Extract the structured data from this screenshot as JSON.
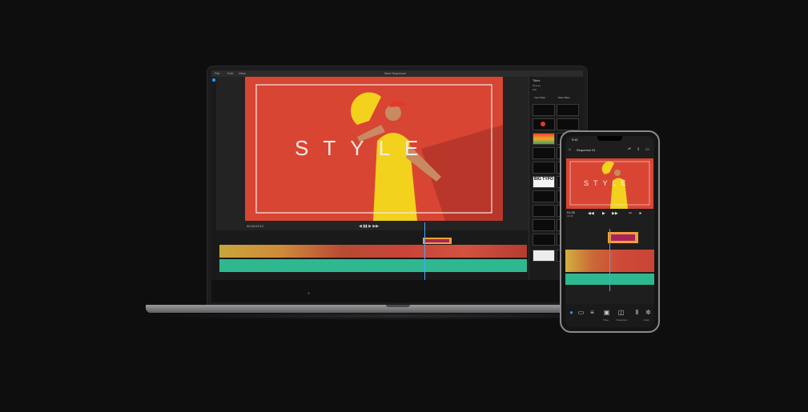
{
  "desktop_app": {
    "window_title": "New Sequence",
    "menu": [
      "File",
      "Edit",
      "View"
    ],
    "video_title_text": "STYLE",
    "timecode": "00:00:03:12",
    "right_panel": {
      "header": "Titles",
      "labels": [
        "Browse",
        "Edit"
      ],
      "buttons": [
        "Your Titles",
        "Most Titles"
      ],
      "thumb_title_text": "BIG TYPO"
    }
  },
  "phone_app": {
    "status_time": "9:41",
    "sequence_title": "Sequence 01",
    "video_title_text": "STYLE",
    "timecode_current": "01:30",
    "timecode_duration": "02:48",
    "toolbar_labels": [
      "Titles",
      "Transitions",
      "Color"
    ]
  },
  "colors": {
    "background": "#0e0e0e",
    "accent_blue": "#2d8ceb",
    "title_clip": "#f0a033",
    "title_clip_inner": "#a8245e",
    "audio_track": "#2fb890",
    "video_bg": "#e04a36",
    "dress_yellow": "#f2d21c"
  },
  "icons": [
    "home-icon",
    "undo-icon",
    "share-icon",
    "chat-icon",
    "play-icon",
    "skip-back-icon",
    "skip-forward-icon",
    "plus-icon",
    "scissors-icon",
    "volume-icon",
    "titles-icon",
    "transitions-icon",
    "color-icon"
  ]
}
